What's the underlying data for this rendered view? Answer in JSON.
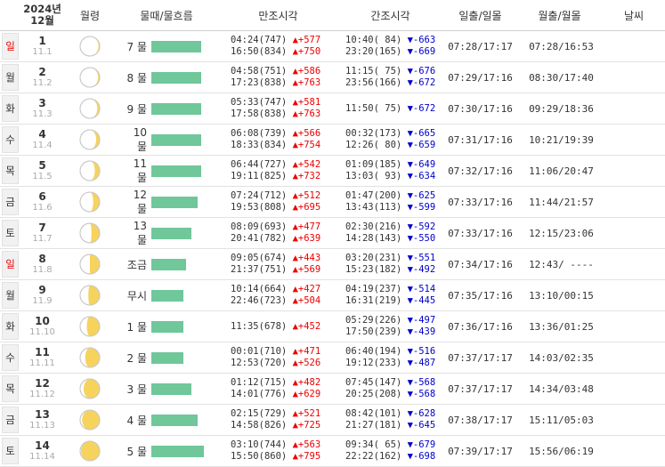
{
  "header": {
    "year": "2024년",
    "month": "12월",
    "moon_phase": "월령",
    "water": "물때/물흐름",
    "high_tide": "만조시각",
    "low_tide": "간조시각",
    "sun": "일출/일몰",
    "moon": "월출/월몰",
    "weather": "날씨"
  },
  "rows": [
    {
      "dow": "일",
      "red": true,
      "day": "1",
      "lunar": "11.1",
      "mul": "7 물",
      "flow": 0.74,
      "illum": 0.06,
      "waxing": true,
      "hi": [
        {
          "t": "04:24",
          "h": "747",
          "d": "577"
        },
        {
          "t": "16:50",
          "h": "834",
          "d": "750"
        }
      ],
      "lo": [
        {
          "t": "10:40",
          "h": " 84",
          "d": "663"
        },
        {
          "t": "23:20",
          "h": "165",
          "d": "669"
        }
      ],
      "sun": "07:28/17:17",
      "moon": "07:28/16:53"
    },
    {
      "dow": "월",
      "red": false,
      "day": "2",
      "lunar": "11.2",
      "mul": "8 물",
      "flow": 0.74,
      "illum": 0.08,
      "waxing": true,
      "hi": [
        {
          "t": "04:58",
          "h": "751",
          "d": "586"
        },
        {
          "t": "17:23",
          "h": "838",
          "d": "763"
        }
      ],
      "lo": [
        {
          "t": "11:15",
          "h": " 75",
          "d": "676"
        },
        {
          "t": "23:56",
          "h": "166",
          "d": "672"
        }
      ],
      "sun": "07:29/17:16",
      "moon": "08:30/17:40"
    },
    {
      "dow": "화",
      "red": false,
      "day": "3",
      "lunar": "11.3",
      "mul": "9 물",
      "flow": 0.74,
      "illum": 0.12,
      "waxing": true,
      "hi": [
        {
          "t": "05:33",
          "h": "747",
          "d": "581"
        },
        {
          "t": "17:58",
          "h": "838",
          "d": "763"
        }
      ],
      "lo": [
        {
          "t": "11:50",
          "h": " 75",
          "d": "672"
        }
      ],
      "sun": "07:30/17:16",
      "moon": "09:29/18:36"
    },
    {
      "dow": "수",
      "red": false,
      "day": "4",
      "lunar": "11.4",
      "mul": "10 물",
      "flow": 0.74,
      "illum": 0.18,
      "waxing": true,
      "hi": [
        {
          "t": "06:08",
          "h": "739",
          "d": "566"
        },
        {
          "t": "18:33",
          "h": "834",
          "d": "754"
        }
      ],
      "lo": [
        {
          "t": "00:32",
          "h": "173",
          "d": "665"
        },
        {
          "t": "12:26",
          "h": " 80",
          "d": "659"
        }
      ],
      "sun": "07:31/17:16",
      "moon": "10:21/19:39"
    },
    {
      "dow": "목",
      "red": false,
      "day": "5",
      "lunar": "11.5",
      "mul": "11 물",
      "flow": 0.74,
      "illum": 0.25,
      "waxing": true,
      "hi": [
        {
          "t": "06:44",
          "h": "727",
          "d": "542"
        },
        {
          "t": "19:11",
          "h": "825",
          "d": "732"
        }
      ],
      "lo": [
        {
          "t": "01:09",
          "h": "185",
          "d": "649"
        },
        {
          "t": "13:03",
          "h": " 93",
          "d": "634"
        }
      ],
      "sun": "07:32/17:16",
      "moon": "11:06/20:47"
    },
    {
      "dow": "금",
      "red": false,
      "day": "6",
      "lunar": "11.6",
      "mul": "12 물",
      "flow": 0.69,
      "illum": 0.33,
      "waxing": true,
      "hi": [
        {
          "t": "07:24",
          "h": "712",
          "d": "512"
        },
        {
          "t": "19:53",
          "h": "808",
          "d": "695"
        }
      ],
      "lo": [
        {
          "t": "01:47",
          "h": "200",
          "d": "625"
        },
        {
          "t": "13:43",
          "h": "113",
          "d": "599"
        }
      ],
      "sun": "07:33/17:16",
      "moon": "11:44/21:57"
    },
    {
      "dow": "토",
      "red": false,
      "day": "7",
      "lunar": "11.7",
      "mul": "13 물",
      "flow": 0.6,
      "illum": 0.42,
      "waxing": true,
      "hi": [
        {
          "t": "08:09",
          "h": "693",
          "d": "477"
        },
        {
          "t": "20:41",
          "h": "782",
          "d": "639"
        }
      ],
      "lo": [
        {
          "t": "02:30",
          "h": "216",
          "d": "592"
        },
        {
          "t": "14:28",
          "h": "143",
          "d": "550"
        }
      ],
      "sun": "07:33/17:16",
      "moon": "12:15/23:06"
    },
    {
      "dow": "일",
      "red": true,
      "day": "8",
      "lunar": "11.8",
      "mul": "조금",
      "flow": 0.52,
      "illum": 0.5,
      "waxing": true,
      "hi": [
        {
          "t": "09:05",
          "h": "674",
          "d": "443"
        },
        {
          "t": "21:37",
          "h": "751",
          "d": "569"
        }
      ],
      "lo": [
        {
          "t": "03:20",
          "h": "231",
          "d": "551"
        },
        {
          "t": "15:23",
          "h": "182",
          "d": "492"
        }
      ],
      "sun": "07:34/17:16",
      "moon": "12:43/ ----"
    },
    {
      "dow": "월",
      "red": false,
      "day": "9",
      "lunar": "11.9",
      "mul": "무시",
      "flow": 0.48,
      "illum": 0.58,
      "waxing": true,
      "hi": [
        {
          "t": "10:14",
          "h": "664",
          "d": "427"
        },
        {
          "t": "22:46",
          "h": "723",
          "d": "504"
        }
      ],
      "lo": [
        {
          "t": "04:19",
          "h": "237",
          "d": "514"
        },
        {
          "t": "16:31",
          "h": "219",
          "d": "445"
        }
      ],
      "sun": "07:35/17:16",
      "moon": "13:10/00:15"
    },
    {
      "dow": "화",
      "red": false,
      "day": "10",
      "lunar": "11.10",
      "mul": "1 물",
      "flow": 0.48,
      "illum": 0.66,
      "waxing": true,
      "hi": [
        {
          "t": "11:35",
          "h": "678",
          "d": "452"
        }
      ],
      "lo": [
        {
          "t": "05:29",
          "h": "226",
          "d": "497"
        },
        {
          "t": "17:50",
          "h": "239",
          "d": "439"
        }
      ],
      "sun": "07:36/17:16",
      "moon": "13:36/01:25"
    },
    {
      "dow": "수",
      "red": false,
      "day": "11",
      "lunar": "11.11",
      "mul": "2 물",
      "flow": 0.48,
      "illum": 0.74,
      "waxing": true,
      "hi": [
        {
          "t": "00:01",
          "h": "710",
          "d": "471"
        },
        {
          "t": "12:53",
          "h": "720",
          "d": "526"
        }
      ],
      "lo": [
        {
          "t": "06:40",
          "h": "194",
          "d": "516"
        },
        {
          "t": "19:12",
          "h": "233",
          "d": "487"
        }
      ],
      "sun": "07:37/17:17",
      "moon": "14:03/02:35"
    },
    {
      "dow": "목",
      "red": false,
      "day": "12",
      "lunar": "11.12",
      "mul": "3 물",
      "flow": 0.6,
      "illum": 0.82,
      "waxing": true,
      "hi": [
        {
          "t": "01:12",
          "h": "715",
          "d": "482"
        },
        {
          "t": "14:01",
          "h": "776",
          "d": "629"
        }
      ],
      "lo": [
        {
          "t": "07:45",
          "h": "147",
          "d": "568"
        },
        {
          "t": "20:25",
          "h": "208",
          "d": "568"
        }
      ],
      "sun": "07:37/17:17",
      "moon": "14:34/03:48"
    },
    {
      "dow": "금",
      "red": false,
      "day": "13",
      "lunar": "11.13",
      "mul": "4 물",
      "flow": 0.69,
      "illum": 0.9,
      "waxing": true,
      "hi": [
        {
          "t": "02:15",
          "h": "729",
          "d": "521"
        },
        {
          "t": "14:58",
          "h": "826",
          "d": "725"
        }
      ],
      "lo": [
        {
          "t": "08:42",
          "h": "101",
          "d": "628"
        },
        {
          "t": "21:27",
          "h": "181",
          "d": "645"
        }
      ],
      "sun": "07:38/17:17",
      "moon": "15:11/05:03"
    },
    {
      "dow": "토",
      "red": false,
      "day": "14",
      "lunar": "11.14",
      "mul": "5 물",
      "flow": 0.78,
      "illum": 0.96,
      "waxing": true,
      "hi": [
        {
          "t": "03:10",
          "h": "744",
          "d": "563"
        },
        {
          "t": "15:50",
          "h": "860",
          "d": "795"
        }
      ],
      "lo": [
        {
          "t": "09:34",
          "h": " 65",
          "d": "679"
        },
        {
          "t": "22:22",
          "h": "162",
          "d": "698"
        }
      ],
      "sun": "07:39/17:17",
      "moon": "15:56/06:19"
    }
  ],
  "colors": {
    "bar": "#6fc79a",
    "moon_lit": "#f6d35c",
    "up": "#e00000",
    "down": "#0000cc"
  }
}
